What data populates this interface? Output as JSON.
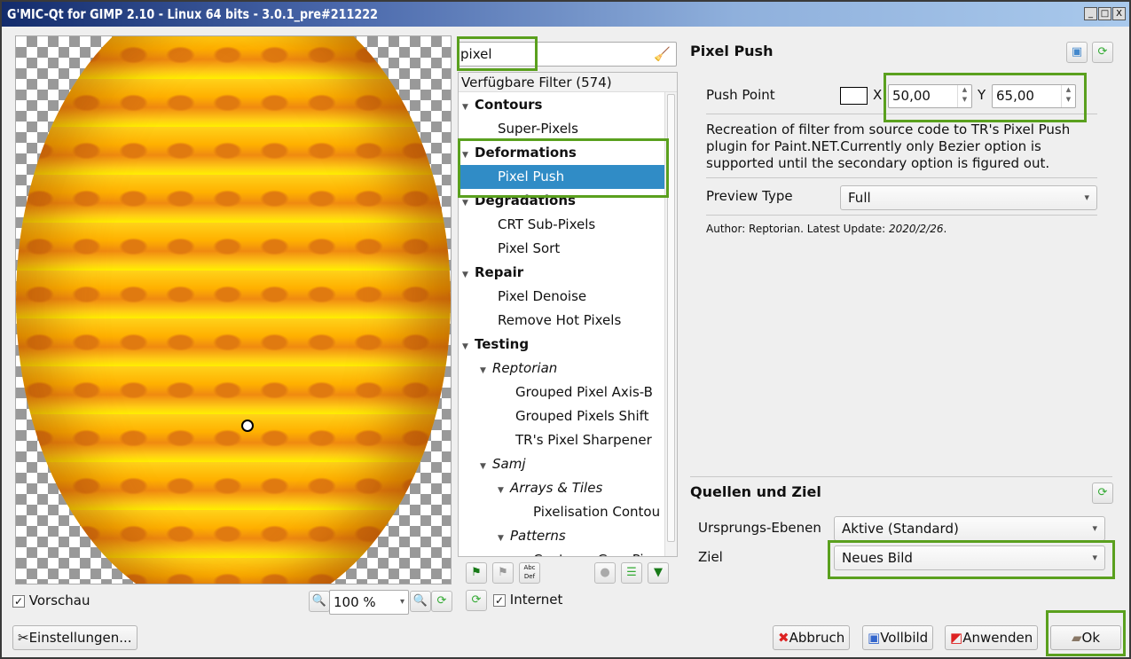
{
  "window": {
    "title": "G'MIC-Qt for GIMP 2.10 - Linux 64 bits - 3.0.1_pre#211222",
    "min": "_",
    "max": "□",
    "close": "X"
  },
  "preview": {
    "checkbox_label": "Vorschau",
    "checked": true,
    "zoom": "100 %",
    "settings_button": "Einstellungen..."
  },
  "filters": {
    "search_value": "pixel",
    "header": "Verfügbare Filter (574)",
    "internet_label": "Internet",
    "internet_checked": true,
    "items": [
      {
        "label": "Contours",
        "kind": "category"
      },
      {
        "label": "Super-Pixels",
        "kind": "filter"
      },
      {
        "label": "Deformations",
        "kind": "category"
      },
      {
        "label": "Pixel Push",
        "kind": "filter",
        "selected": true
      },
      {
        "label": "Degradations",
        "kind": "category"
      },
      {
        "label": "CRT Sub-Pixels",
        "kind": "filter"
      },
      {
        "label": "Pixel Sort",
        "kind": "filter"
      },
      {
        "label": "Repair",
        "kind": "category"
      },
      {
        "label": "Pixel Denoise",
        "kind": "filter"
      },
      {
        "label": "Remove Hot Pixels",
        "kind": "filter"
      },
      {
        "label": "Testing",
        "kind": "category"
      },
      {
        "label": "Reptorian",
        "kind": "subfolder"
      },
      {
        "label": "Grouped Pixel Axis-B",
        "kind": "filter2"
      },
      {
        "label": "Grouped Pixels Shift",
        "kind": "filter2"
      },
      {
        "label": "TR's Pixel Sharpener",
        "kind": "filter2"
      },
      {
        "label": "Samj",
        "kind": "subfolder"
      },
      {
        "label": "Arrays & Tiles",
        "kind": "subfolder2"
      },
      {
        "label": "Pixelisation Contou",
        "kind": "filter3"
      },
      {
        "label": "Patterns",
        "kind": "subfolder2"
      },
      {
        "label": "Contours Gros Pixe",
        "kind": "filter3"
      }
    ]
  },
  "params": {
    "title": "Pixel Push",
    "push_point_label": "Push Point",
    "x_label": "X",
    "x_value": "50,00",
    "y_label": "Y",
    "y_value": "65,00",
    "description": "Recreation of filter from source code to TR's Pixel Push plugin for Paint.NET.Currently only Bezier option is supported until the secondary option is figured out.",
    "preview_type_label": "Preview Type",
    "preview_type_value": "Full",
    "author": "Author: Reptorian. Latest Update: ",
    "date": "2020/2/26",
    "date_end": "."
  },
  "io": {
    "title": "Quellen und Ziel",
    "source_label": "Ursprungs-Ebenen",
    "source_value": "Aktive (Standard)",
    "target_label": "Ziel",
    "target_value": "Neues Bild"
  },
  "buttons": {
    "cancel": "Abbruch",
    "fullscreen": "Vollbild",
    "apply": "Anwenden",
    "ok": "Ok"
  },
  "colors": {
    "highlight": "#5aa01e",
    "selection": "#308cc6"
  }
}
